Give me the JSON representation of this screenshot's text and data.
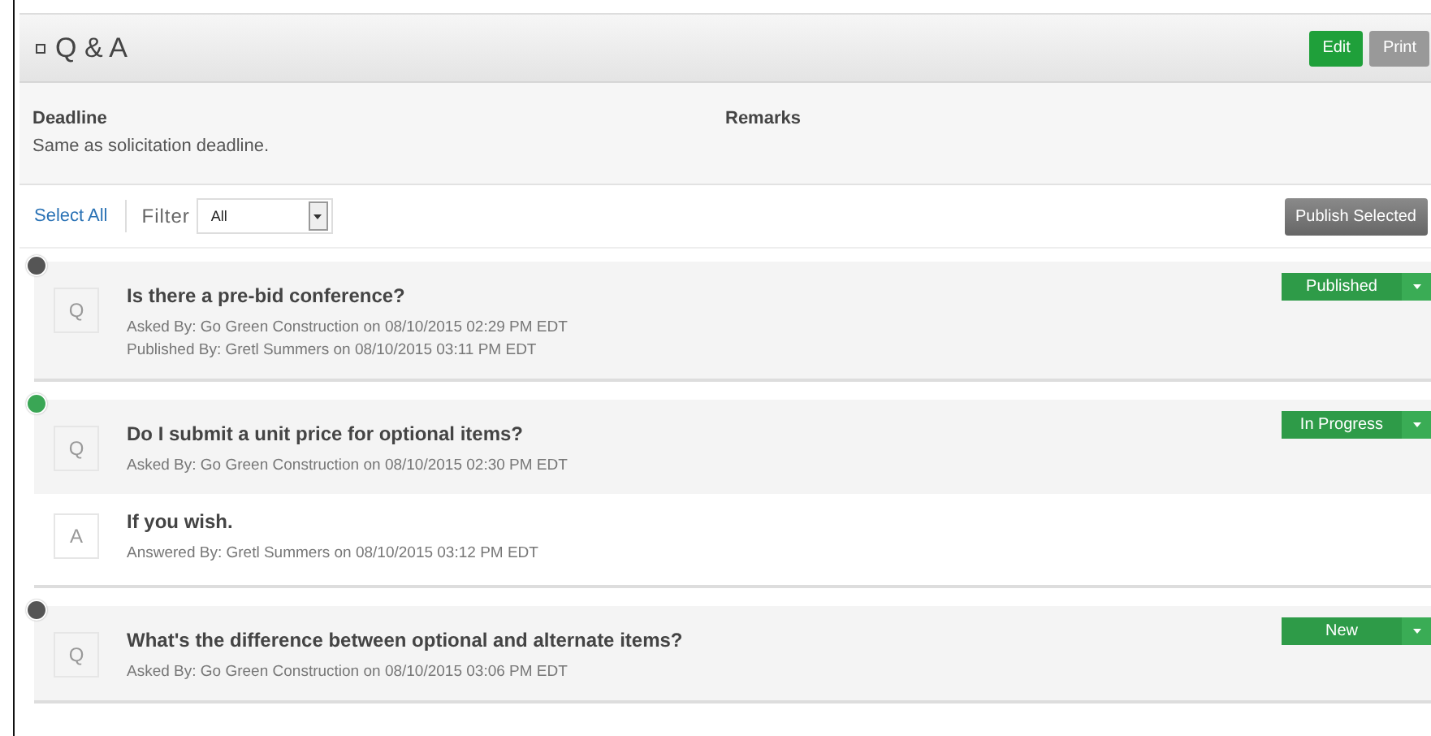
{
  "panel": {
    "title": "Q & A",
    "buttons": [
      {
        "label": "Edit",
        "kind": "primary"
      },
      {
        "label": "Print",
        "kind": "secondary"
      }
    ]
  },
  "info": [
    {
      "label": "Deadline",
      "value": "Same as solicitation deadline."
    },
    {
      "label": "Remarks"
    }
  ],
  "toolbar": {
    "select_all": "Select All",
    "filter_label": "Filter",
    "filter_value": "All",
    "publish": "Publish Selected"
  },
  "items": [
    {
      "color": "#555555",
      "status": "Published",
      "entries": [
        {
          "letter": "Q",
          "text": "Is there a pre-bid conference?",
          "meta": [
            "Asked By: Go Green Construction on 08/10/2015 02:29 PM EDT",
            "Published By: Gretl Summers on 08/10/2015 03:11 PM EDT"
          ]
        }
      ]
    },
    {
      "color": "#3aa655",
      "status": "In Progress",
      "entries": [
        {
          "letter": "Q",
          "text": "Do I submit a unit price for optional items?",
          "meta": [
            "Asked By: Go Green Construction on 08/10/2015 02:30 PM EDT"
          ]
        },
        {
          "letter": "A",
          "text": "If you wish.",
          "meta": [
            "Answered By: Gretl Summers on 08/10/2015 03:12 PM EDT"
          ]
        }
      ]
    },
    {
      "color": "#555555",
      "status": "New",
      "entries": [
        {
          "letter": "Q",
          "text": "What's the difference between optional and alternate items?",
          "meta": [
            "Asked By: Go Green Construction on 08/10/2015 03:06 PM EDT"
          ]
        }
      ]
    }
  ]
}
